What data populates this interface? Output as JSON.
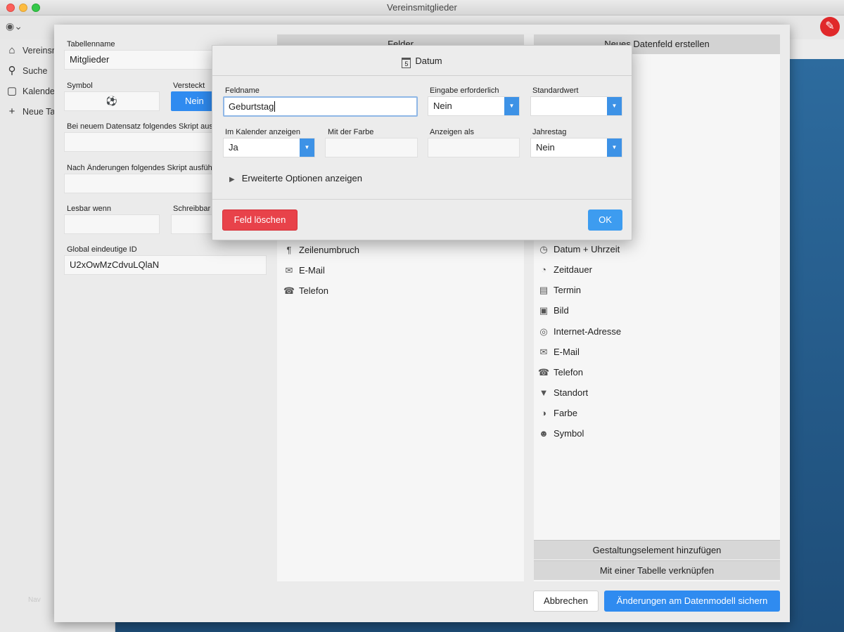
{
  "window": {
    "title": "Vereinsmitglieder"
  },
  "sidebar": {
    "items": [
      {
        "icon": "home-icon",
        "glyph": "⌂",
        "label": "Vereinsmitglieder"
      },
      {
        "icon": "search-icon",
        "glyph": "⚲",
        "label": "Suche"
      },
      {
        "icon": "calendar-icon",
        "glyph": "▢",
        "label": "Kalender"
      },
      {
        "icon": "plus-icon",
        "glyph": "+",
        "label": "Neue Tabelle"
      }
    ],
    "bottom_label": "Nav"
  },
  "left_panel": {
    "table_name_label": "Tabellenname",
    "table_name_value": "Mitglieder",
    "symbol_label": "Symbol",
    "symbol_glyph": "⚽",
    "hidden_label": "Versteckt",
    "hidden_value": "Nein",
    "new_record_script_label": "Bei neuem Datensatz folgendes Skript ausführen",
    "after_change_script_label": "Nach Änderungen folgendes Skript ausführen",
    "readable_when_label": "Lesbar wenn",
    "writable_when_label": "Schreibbar wenn",
    "global_id_label": "Global eindeutige ID",
    "global_id_value": "U2xOwMzCdvuLQlaN"
  },
  "fields_column": {
    "header": "Felder",
    "items": [
      {
        "icon": "pilcrow-icon",
        "glyph": "¶",
        "label": "Zeilenumbruch"
      },
      {
        "icon": "email-icon",
        "glyph": "✉",
        "label": "E-Mail"
      },
      {
        "icon": "phone-icon",
        "glyph": "☎",
        "label": "Telefon"
      }
    ]
  },
  "new_field_column": {
    "header": "Neues Datenfeld erstellen",
    "items": [
      {
        "icon": "datetime-icon",
        "glyph": "◷",
        "label": "Datum + Uhrzeit"
      },
      {
        "icon": "duration-icon",
        "glyph": "◔",
        "label": "Zeitdauer"
      },
      {
        "icon": "appointment-icon",
        "glyph": "▤",
        "label": "Termin"
      },
      {
        "icon": "image-icon",
        "glyph": "▣",
        "label": "Bild"
      },
      {
        "icon": "globe-icon",
        "glyph": "◎",
        "label": "Internet-Adresse"
      },
      {
        "icon": "email-icon",
        "glyph": "✉",
        "label": "E-Mail"
      },
      {
        "icon": "phone-icon",
        "glyph": "☎",
        "label": "Telefon"
      },
      {
        "icon": "location-pin-icon",
        "glyph": "▼",
        "label": "Standort"
      },
      {
        "icon": "color-icon",
        "glyph": "◑",
        "label": "Farbe"
      },
      {
        "icon": "symbol-icon",
        "glyph": "☻",
        "label": "Symbol"
      }
    ],
    "add_design_element": "Gestaltungselement hinzufügen",
    "link_table": "Mit einer Tabelle verknüpfen"
  },
  "footer": {
    "cancel": "Abbrechen",
    "save": "Änderungen am Datenmodell sichern"
  },
  "dialog": {
    "title": "Datum",
    "calendar_glyph": "5",
    "field_name_label": "Feldname",
    "field_name_value": "Geburtstag",
    "required_label": "Eingabe erforderlich",
    "required_value": "Nein",
    "default_label": "Standardwert",
    "default_value": "",
    "show_in_calendar_label": "Im Kalender anzeigen",
    "show_in_calendar_value": "Ja",
    "with_color_label": "Mit der Farbe",
    "display_as_label": "Anzeigen als",
    "anniversary_label": "Jahrestag",
    "anniversary_value": "Nein",
    "advanced_options": "Erweiterte Optionen anzeigen",
    "delete_button": "Feld löschen",
    "ok_button": "OK"
  },
  "colors": {
    "accent_blue": "#2f8bf0",
    "danger_red": "#e8424a",
    "tool_red": "#e0282a"
  }
}
